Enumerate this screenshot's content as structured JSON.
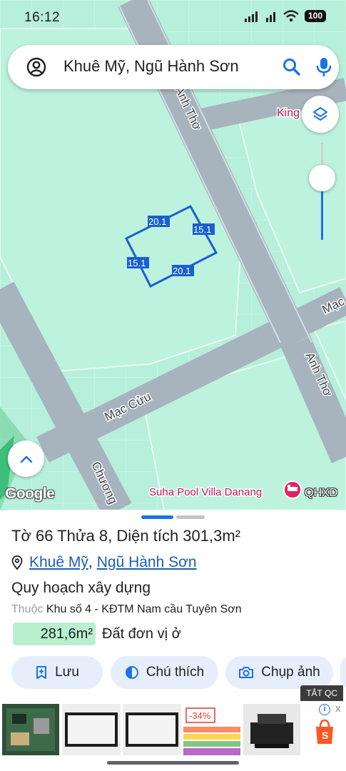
{
  "status_bar": {
    "time": "16:12",
    "battery": "100"
  },
  "search": {
    "query": "Khuê Mỹ, Ngũ Hành Sơn"
  },
  "map": {
    "street_labels": {
      "anh_tho_north": "Anh Thơ",
      "anh_tho_south": "Anh Thơ",
      "mac_cuu": "Mạc Cửu",
      "mac_cuu_east": "Mạc",
      "chuong": "Chương",
      "king": "King"
    },
    "poi_label": "Suha Pool Villa Danang",
    "parcel_edges": [
      "20.1",
      "15.1",
      "20.1",
      "15.1"
    ],
    "google_logo": "Google",
    "overlay_label": "QHXD"
  },
  "parcel": {
    "title": "Tờ 66 Thửa 8, Diện tích 301,3m²",
    "ward": "Khuê Mỹ",
    "separator": ",",
    "district": "Ngũ Hành Sơn",
    "plan_heading": "Quy hoạch xây dựng",
    "belongs_label": "Thuộc",
    "belongs_value": "Khu số 4 - KĐTM Nam cầu Tuyên Sơn",
    "area": "281,6m²",
    "land_type": "Đất đơn vị ở"
  },
  "actions": {
    "save": "Lưu",
    "legend": "Chú thích",
    "capture": "Chụp ảnh"
  },
  "ad": {
    "tag": "TẮT QC",
    "discount": "-34%",
    "info_icon": "i",
    "close_icon": "x"
  },
  "colors": {
    "accent": "#1a73e8",
    "map_block": "#b9f0dd",
    "road": "#a7b3bd",
    "parcel_outline": "#1a5fd0",
    "area_chip": "#b8f0cf",
    "poi": "#c2185b"
  },
  "icons": [
    "account-circle-icon",
    "search-icon",
    "mic-icon",
    "layers-icon",
    "chevron-up-icon",
    "location-pin-icon",
    "bookmark-add-icon",
    "legend-icon",
    "camera-icon",
    "hotel-icon",
    "info-icon",
    "shopping-bag-icon"
  ]
}
